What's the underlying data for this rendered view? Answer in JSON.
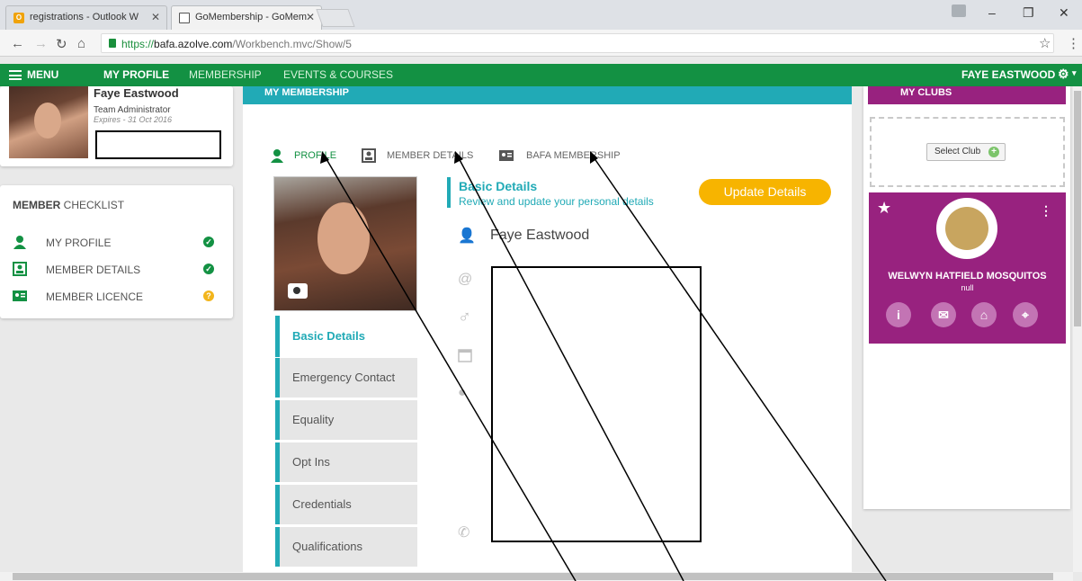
{
  "browser": {
    "tabs": [
      {
        "title": "registrations - Outlook W"
      },
      {
        "title": "GoMembership - GoMem"
      }
    ],
    "url_secure": "https://",
    "url_host": "bafa.azolve.com",
    "url_path": "/Workbench.mvc/Show/5"
  },
  "appnav": {
    "menu": "MENU",
    "my_profile": "MY PROFILE",
    "membership": "MEMBERSHIP",
    "events": "EVENTS & COURSES",
    "user": "FAYE EASTWOOD"
  },
  "profile": {
    "name": "Faye Eastwood",
    "role": "Team Administrator",
    "expires": "Expires - 31 Oct 2016"
  },
  "checklist": {
    "title_bold": "MEMBER",
    "title_rest": " CHECKLIST",
    "items": [
      {
        "label": "MY PROFILE",
        "status": "complete"
      },
      {
        "label": "MEMBER DETAILS",
        "status": "complete"
      },
      {
        "label": "MEMBER LICENCE",
        "status": "pending"
      }
    ]
  },
  "main": {
    "header": "MY MEMBERSHIP",
    "tabs": [
      {
        "label": "PROFILE"
      },
      {
        "label": "MEMBER DETAILS"
      },
      {
        "label": "BAFA MEMBERSHIP"
      }
    ],
    "side_menu": [
      "Basic Details",
      "Emergency Contact",
      "Equality",
      "Opt Ins",
      "Credentials",
      "Qualifications"
    ],
    "section_title": "Basic Details",
    "section_sub": "Review and update your personal details",
    "update_button": "Update Details",
    "full_name": "Faye Eastwood"
  },
  "clubs": {
    "header": "MY CLUBS",
    "select_club": "Select Club",
    "club_name": "WELWYN HATFIELD MOSQUITOS",
    "club_sub": "null"
  },
  "colors": {
    "green": "#139143",
    "teal": "#21aab6",
    "purple": "#98227f",
    "orange": "#f7b400"
  }
}
